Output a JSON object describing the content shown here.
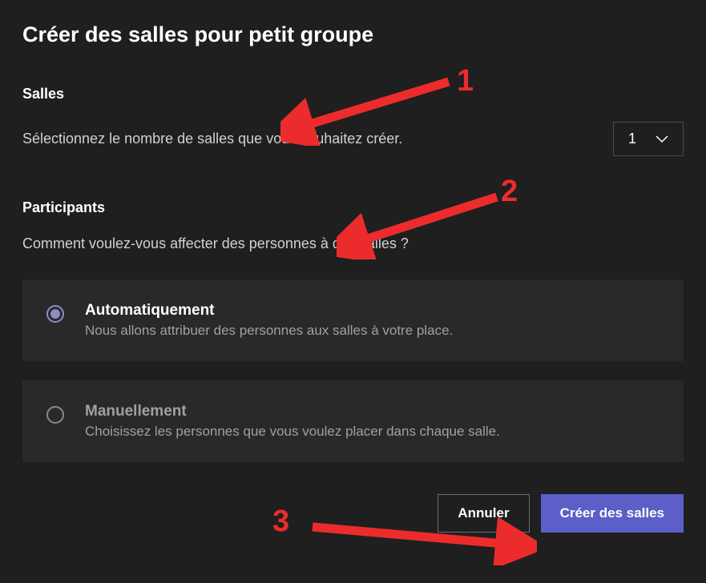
{
  "dialog": {
    "title": "Créer des salles pour petit groupe"
  },
  "rooms": {
    "label": "Salles",
    "description": "Sélectionnez le nombre de salles que vous souhaitez créer.",
    "selected_value": "1"
  },
  "participants": {
    "label": "Participants",
    "description": "Comment voulez-vous affecter des personnes à des salles ?",
    "options": [
      {
        "title": "Automatiquement",
        "description": "Nous allons attribuer des personnes aux salles à votre place.",
        "selected": true
      },
      {
        "title": "Manuellement",
        "description": "Choisissez les personnes que vous voulez placer dans chaque salle.",
        "selected": false
      }
    ]
  },
  "footer": {
    "cancel_label": "Annuler",
    "create_label": "Créer des salles"
  },
  "annotations": {
    "one": "1",
    "two": "2",
    "three": "3"
  },
  "colors": {
    "background": "#1f1f1f",
    "card": "#292929",
    "primary": "#5b5fc7",
    "accent_radio": "#8b8cc7",
    "annotation_red": "#ec2c2c",
    "text_primary": "#ffffff",
    "text_secondary": "#d1d1d1",
    "text_muted": "#a0a0a0"
  }
}
